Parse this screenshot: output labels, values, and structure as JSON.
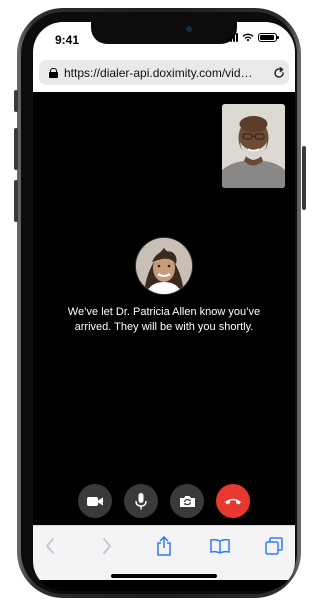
{
  "status_bar": {
    "time": "9:41"
  },
  "browser": {
    "url": "https://dialer-api.doximity.com/vid…"
  },
  "call": {
    "message": "We’ve let Dr. Patricia Allen know you’ve arrived. They will be with you shortly."
  },
  "icons": {
    "video": "video-camera-icon",
    "mic": "microphone-icon",
    "flip": "camera-flip-icon",
    "end": "end-call-icon",
    "back": "chevron-left-icon",
    "forward": "chevron-right-icon",
    "share": "share-icon",
    "bookmarks": "book-icon",
    "tabs": "tabs-icon"
  },
  "colors": {
    "end_call": "#e8382f",
    "toolbar_icon": "#2f7bf6"
  }
}
